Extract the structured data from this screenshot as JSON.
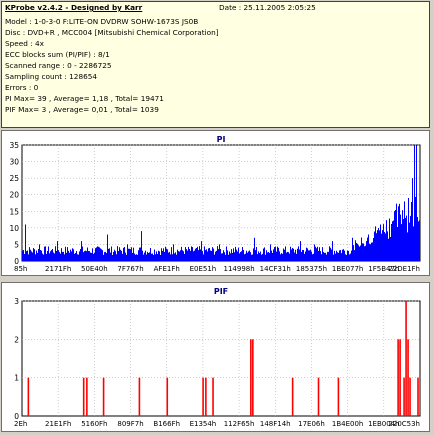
{
  "info": {
    "title": "KProbe v2.4.2 - Designed by Karr",
    "date": "Date : 25.11.2005 2:05:25",
    "lines": [
      "Model : 1-0-3-0 F:LITE-ON DVDRW SOHW-1673S JS0B",
      "Disc : DVD+R , MCC004 [Mitsubishi Chemical Corporation]",
      "Speed : 4x",
      "ECC blocks sum (PI/PIF) : 8/1",
      "Scanned range : 0 - 2286725",
      "Sampling count : 128654",
      "Errors : 0",
      "PI Max= 39 , Average= 1,18 , Total= 19471",
      "PIF Max= 3 , Average= 0,01 , Total= 1039"
    ]
  },
  "chart_data": [
    {
      "type": "bar",
      "title": "PI",
      "ylim": [
        0,
        35
      ],
      "yticks": [
        "0",
        "5",
        "10",
        "15",
        "20",
        "25",
        "30",
        "35"
      ],
      "xticks": [
        "85h",
        "2171Fh",
        "50E40h",
        "7F767h",
        "AFE1Fh",
        "E0E51h",
        "114998h",
        "14CF31h",
        "185375h",
        "1BE077h",
        "1F5B47h",
        "22DE1Fh"
      ],
      "grid": true,
      "color": "#0000ff",
      "baseline": 3,
      "spikes": [
        [
          0.01,
          11
        ],
        [
          0.045,
          5
        ],
        [
          0.09,
          6
        ],
        [
          0.15,
          6
        ],
        [
          0.215,
          8
        ],
        [
          0.265,
          5
        ],
        [
          0.3,
          9
        ],
        [
          0.38,
          5
        ],
        [
          0.45,
          6
        ],
        [
          0.495,
          5
        ],
        [
          0.585,
          7
        ],
        [
          0.625,
          5
        ],
        [
          0.7,
          6
        ],
        [
          0.735,
          5
        ],
        [
          0.78,
          6
        ],
        [
          0.83,
          7
        ],
        [
          0.87,
          8
        ],
        [
          0.9,
          11
        ],
        [
          0.93,
          12
        ],
        [
          0.95,
          14
        ],
        [
          0.96,
          18
        ],
        [
          0.97,
          19
        ],
        [
          0.98,
          25
        ],
        [
          0.985,
          38
        ],
        [
          0.99,
          35
        ]
      ],
      "tail_rise": [
        0.82,
        1.0,
        3,
        18
      ]
    },
    {
      "type": "bar",
      "title": "PIF",
      "ylim": [
        0,
        3
      ],
      "yticks": [
        "0",
        "1",
        "2",
        "3"
      ],
      "xticks": [
        "2Eh",
        "21E1Fh",
        "5160Fh",
        "809F7h",
        "B166Fh",
        "E1354h",
        "112F65h",
        "148F14h",
        "17E06h",
        "1B4E00h",
        "1EB004h",
        "220C53h"
      ],
      "grid": true,
      "color": "#ff0000",
      "bars": [
        [
          0.016,
          1
        ],
        [
          0.155,
          1
        ],
        [
          0.163,
          1
        ],
        [
          0.205,
          1
        ],
        [
          0.295,
          1
        ],
        [
          0.365,
          1
        ],
        [
          0.455,
          1
        ],
        [
          0.462,
          1
        ],
        [
          0.48,
          1
        ],
        [
          0.575,
          2
        ],
        [
          0.58,
          2
        ],
        [
          0.68,
          1
        ],
        [
          0.745,
          1
        ],
        [
          0.795,
          1
        ],
        [
          0.945,
          2
        ],
        [
          0.95,
          2
        ],
        [
          0.96,
          1
        ],
        [
          0.965,
          3
        ],
        [
          0.97,
          2
        ],
        [
          0.975,
          1
        ],
        [
          0.995,
          1
        ]
      ]
    }
  ]
}
